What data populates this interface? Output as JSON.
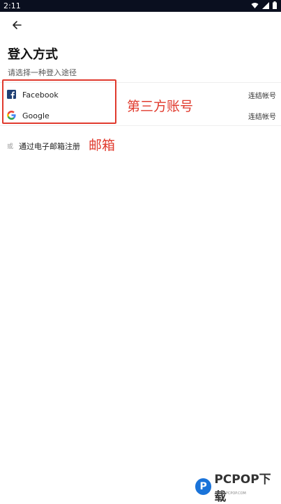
{
  "status_bar": {
    "time": "2:11"
  },
  "header": {
    "title": "登入方式",
    "subtitle": "请选择一种登入途径"
  },
  "providers": [
    {
      "name": "Facebook",
      "action": "连结帐号",
      "icon": "facebook-icon",
      "color": "#1877f2"
    },
    {
      "name": "Google",
      "action": "连结帐号",
      "icon": "google-icon",
      "color": "#4285f4"
    }
  ],
  "email_option": {
    "prefix": "或",
    "label": "通过电子邮箱注册"
  },
  "annotations": {
    "third_party": "第三方账号",
    "email": "邮箱",
    "color": "#e03a2d"
  },
  "watermark": {
    "brand": "PCPOP下载",
    "tagline": "WWW.PCPOP.COM"
  }
}
